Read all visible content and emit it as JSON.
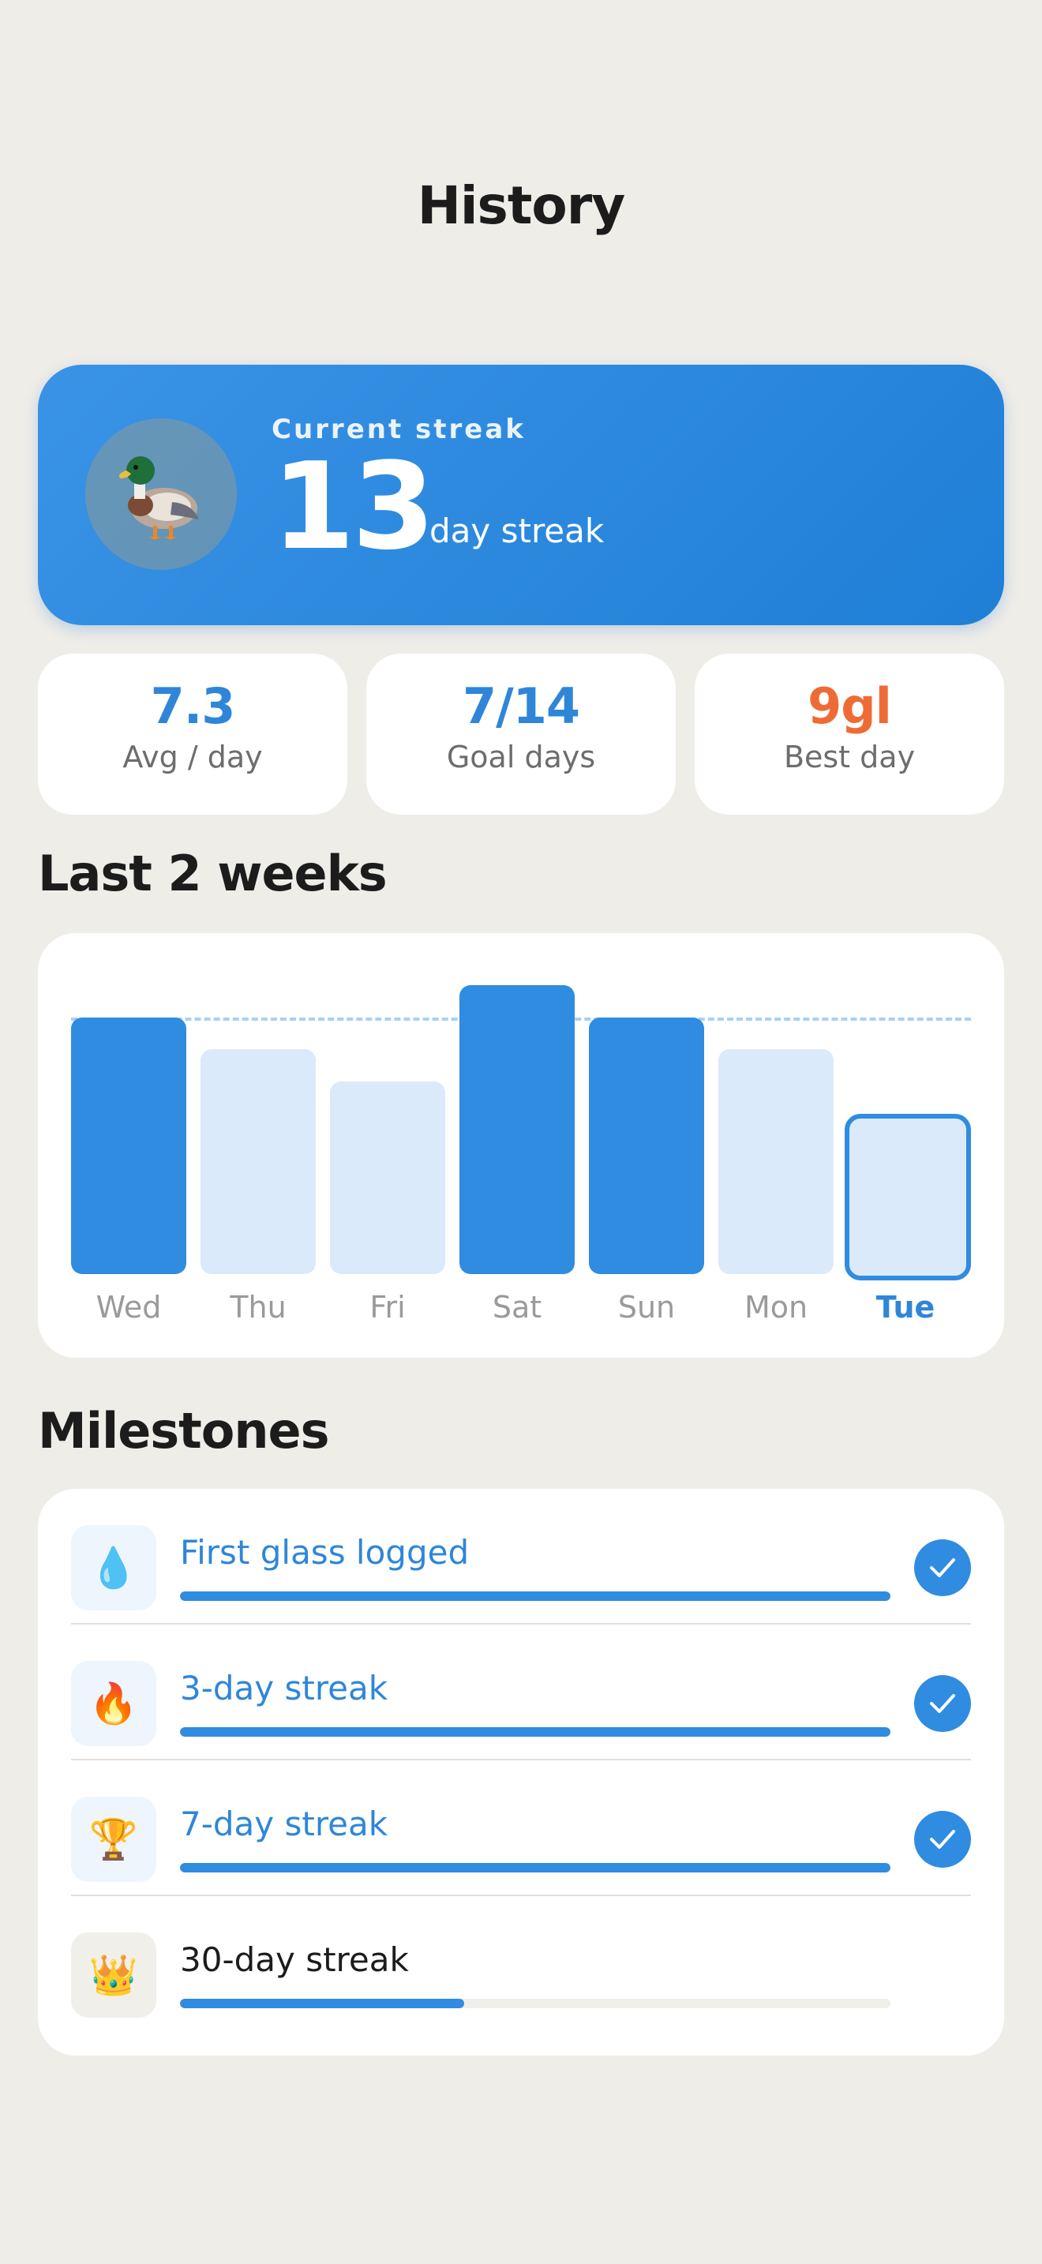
{
  "header": {
    "title": "History"
  },
  "streak": {
    "label": "Current streak",
    "count": "13",
    "suffix": "day streak"
  },
  "stats": [
    {
      "value": "7.3",
      "label": "Avg / day"
    },
    {
      "value": "7/14",
      "label": "Goal days"
    },
    {
      "value": "9gl",
      "label": "Best day"
    }
  ],
  "chart": {
    "title": "Last 2 weeks"
  },
  "chart_data": {
    "type": "bar",
    "categories": [
      "Wed",
      "Thu",
      "Fri",
      "Sat",
      "Sun",
      "Mon",
      "Tue"
    ],
    "values": [
      8,
      7,
      6,
      9,
      8,
      7,
      5
    ],
    "goal": 8,
    "ylim": [
      0,
      9
    ],
    "goal_met": [
      true,
      false,
      false,
      true,
      true,
      false,
      false
    ],
    "highlight_index": 6,
    "colors": {
      "met": "#2f8ce0",
      "unmet": "#dbeafb",
      "goal_line": "#a9d0f3"
    }
  },
  "milestones": {
    "title": "Milestones",
    "items": [
      {
        "icon": "droplet-icon",
        "glyph": "💧",
        "label": "First glass logged",
        "progress": 1.0,
        "done": true
      },
      {
        "icon": "fire-icon",
        "glyph": "🔥",
        "label": "3-day streak",
        "progress": 1.0,
        "done": true
      },
      {
        "icon": "trophy-icon",
        "glyph": "🏆",
        "label": "7-day streak",
        "progress": 1.0,
        "done": true
      },
      {
        "icon": "crown-icon",
        "glyph": "👑",
        "label": "30-day streak",
        "progress": 0.4,
        "done": false
      }
    ]
  },
  "colors": {
    "accent": "#2f86d9",
    "best": "#ef6b35",
    "background": "#efede8"
  }
}
